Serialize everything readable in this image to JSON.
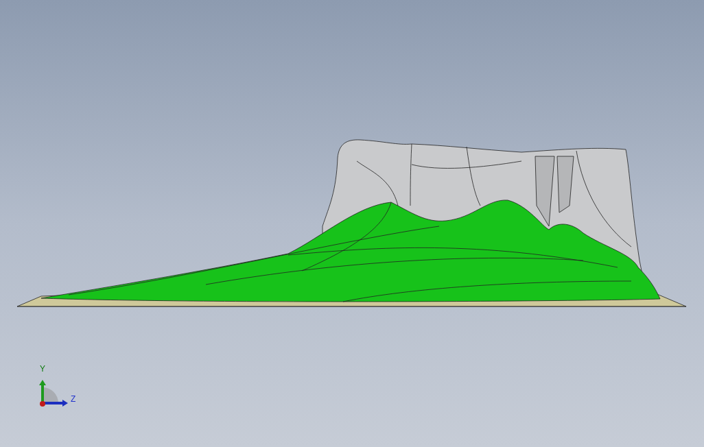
{
  "view_triad": {
    "y_axis": {
      "label": "Y"
    },
    "z_axis": {
      "label": "Z"
    }
  }
}
